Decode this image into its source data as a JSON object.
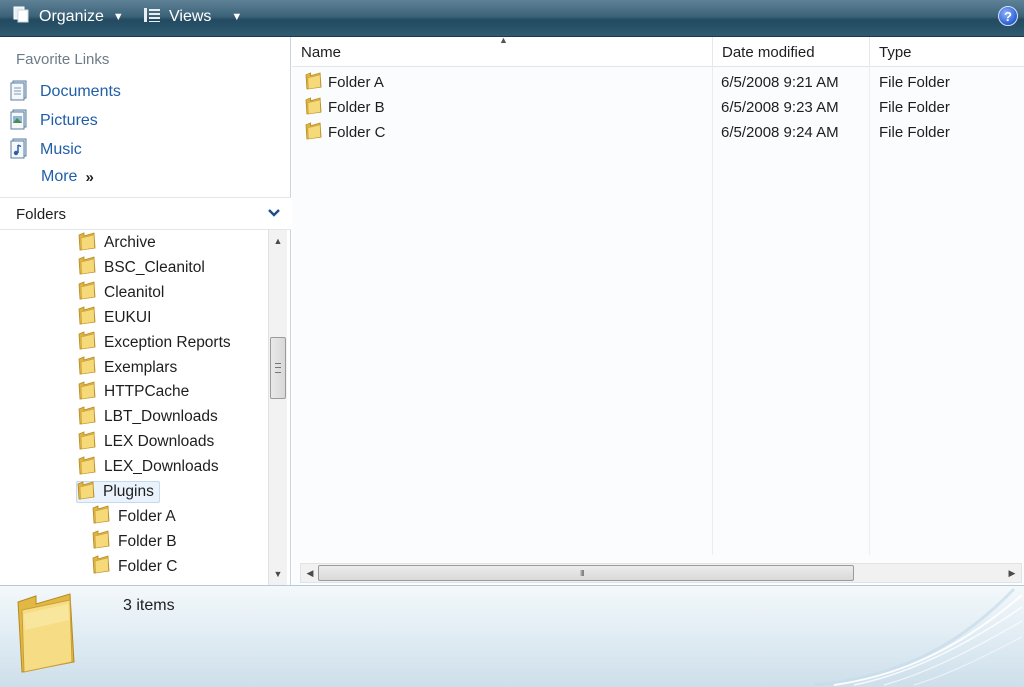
{
  "toolbar": {
    "organize_label": "Organize",
    "views_label": "Views",
    "help_label": "?"
  },
  "favorite_links": {
    "heading": "Favorite Links",
    "items": [
      {
        "label": "Documents",
        "icon": "documents-icon"
      },
      {
        "label": "Pictures",
        "icon": "pictures-icon"
      },
      {
        "label": "Music",
        "icon": "music-icon"
      }
    ],
    "more_label": "More",
    "more_chevron": "»"
  },
  "folders": {
    "heading": "Folders",
    "tree": [
      {
        "label": "Archive",
        "level": 0,
        "selected": false
      },
      {
        "label": "BSC_Cleanitol",
        "level": 0,
        "selected": false
      },
      {
        "label": "Cleanitol",
        "level": 0,
        "selected": false
      },
      {
        "label": "EUKUI",
        "level": 0,
        "selected": false
      },
      {
        "label": "Exception Reports",
        "level": 0,
        "selected": false
      },
      {
        "label": "Exemplars",
        "level": 0,
        "selected": false
      },
      {
        "label": "HTTPCache",
        "level": 0,
        "selected": false
      },
      {
        "label": "LBT_Downloads",
        "level": 0,
        "selected": false
      },
      {
        "label": "LEX Downloads",
        "level": 0,
        "selected": false
      },
      {
        "label": "LEX_Downloads",
        "level": 0,
        "selected": false
      },
      {
        "label": "Plugins",
        "level": 0,
        "selected": true
      },
      {
        "label": "Folder A",
        "level": 1,
        "selected": false
      },
      {
        "label": "Folder B",
        "level": 1,
        "selected": false
      },
      {
        "label": "Folder C",
        "level": 1,
        "selected": false
      }
    ]
  },
  "file_list": {
    "columns": [
      "Name",
      "Date modified",
      "Type"
    ],
    "rows": [
      {
        "name": "Folder A",
        "date": "6/5/2008 9:21 AM",
        "type": "File Folder"
      },
      {
        "name": "Folder B",
        "date": "6/5/2008 9:23 AM",
        "type": "File Folder"
      },
      {
        "name": "Folder C",
        "date": "6/5/2008 9:24 AM",
        "type": "File Folder"
      }
    ]
  },
  "details": {
    "item_count": "3 items"
  },
  "colors": {
    "toolbar_dark": "#224a60",
    "link_blue": "#1f5ea8",
    "folder_yellow": "#f2c94c"
  }
}
